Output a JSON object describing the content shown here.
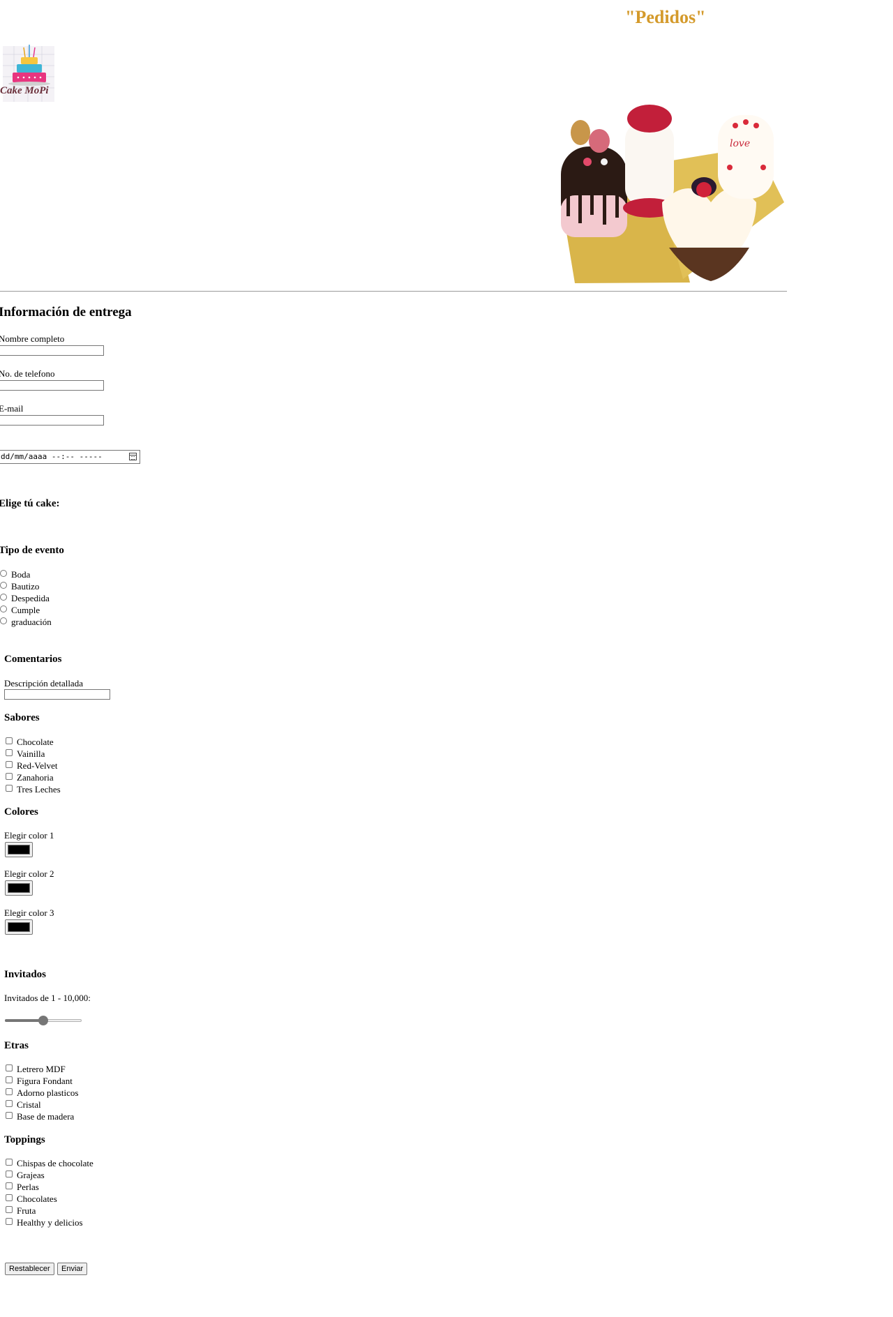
{
  "header": {
    "title": "\"Pedidos\"",
    "logo_text": "Cake MoPi"
  },
  "delivery": {
    "heading": "Información de entrega",
    "name_label": "Nombre completo",
    "name_value": "",
    "phone_label": "No. de telefono",
    "phone_value": "",
    "email_label": "E-mail",
    "email_value": "",
    "datetime_placeholder": "dd/mm/aaaa --:-- -----"
  },
  "cake": {
    "heading": "Elige tú cake:"
  },
  "event": {
    "heading": "Tipo de evento",
    "options": [
      "Boda",
      "Bautizo",
      "Despedida",
      "Cumple",
      "graduación"
    ]
  },
  "comments": {
    "heading": "Comentarios",
    "description_label": "Descripción detallada",
    "description_value": ""
  },
  "flavors": {
    "heading": "Sabores",
    "options": [
      "Chocolate",
      "Vainilla",
      "Red-Velvet",
      "Zanahoria",
      "Tres Leches"
    ]
  },
  "colors": {
    "heading": "Colores",
    "pickers": [
      {
        "label": "Elegir color 1",
        "value": "#000000"
      },
      {
        "label": "Elegir color 2",
        "value": "#000000"
      },
      {
        "label": "Elegir color 3",
        "value": "#000000"
      }
    ]
  },
  "guests": {
    "heading": "Invitados",
    "range_label": "Invitados de 1 - 10,000:",
    "slider_fraction": 0.5
  },
  "extras": {
    "heading": "Etras",
    "options": [
      "Letrero MDF",
      "Figura Fondant",
      "Adorno plasticos",
      "Cristal",
      "Base de madera"
    ]
  },
  "toppings": {
    "heading": "Toppings",
    "options": [
      "Chispas de chocolate",
      "Grajeas",
      "Perlas",
      "Chocolates",
      "Fruta",
      "Healthy y delicios"
    ]
  },
  "actions": {
    "reset_label": "Restablecer",
    "submit_label": "Enviar"
  },
  "colors_theme": {
    "title": "#d49a2b",
    "divider": "#9a9a9a"
  }
}
